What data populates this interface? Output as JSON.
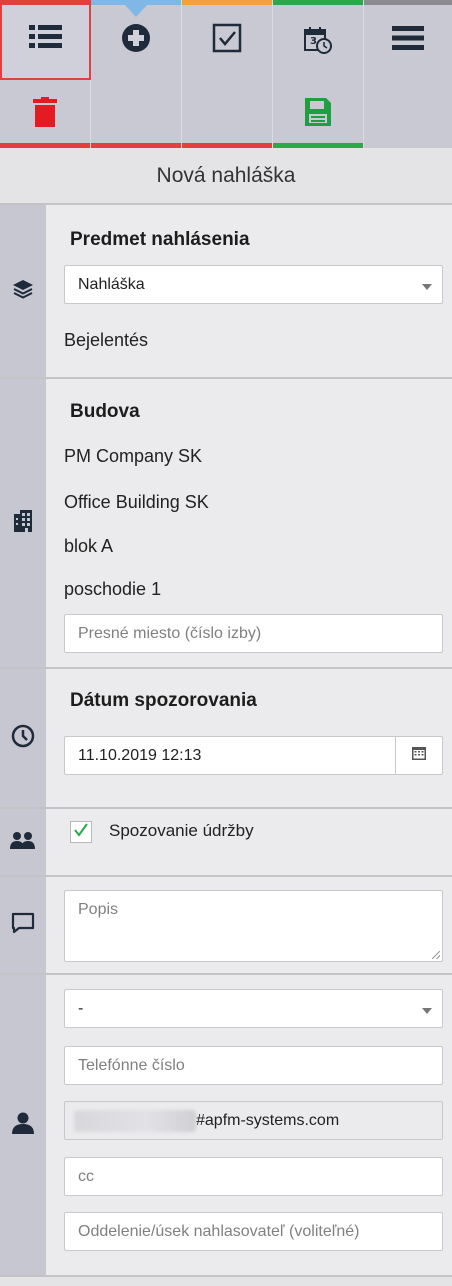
{
  "toolbar": {
    "row1": [
      {
        "name": "list-icon",
        "strip": "#e0403e",
        "selected": true
      },
      {
        "name": "add-circle-icon",
        "strip": "#7fb8e6"
      },
      {
        "name": "checkbox-icon",
        "strip": "#f0a03c"
      },
      {
        "name": "calendar-clock-icon",
        "strip": "#2aa84a"
      },
      {
        "name": "menu-icon",
        "strip": "#8a8a90"
      }
    ],
    "row2": [
      {
        "name": "delete-icon",
        "strip": "#e0403e",
        "color": "#e31b23"
      },
      {
        "name": "empty",
        "strip": "#e0403e"
      },
      {
        "name": "empty",
        "strip": "#e0403e"
      },
      {
        "name": "save-icon",
        "strip": "#2aa84a",
        "color": "#1fa040"
      },
      {
        "name": "empty",
        "strip": "#c9c9d3"
      }
    ],
    "calendar_icon_text": "3"
  },
  "title": "Nová nahláška",
  "subject": {
    "heading": "Predmet nahlásenia",
    "select_value": "Nahláška",
    "secondary_text": "Bejelentés"
  },
  "building": {
    "heading": "Budova",
    "lines": [
      "PM Company SK",
      "Office Building SK",
      "blok A",
      "poschodie 1"
    ],
    "location_placeholder": "Presné miesto (číslo izby)"
  },
  "date": {
    "heading": "Dátum spozorovania",
    "value": "11.10.2019 12:13"
  },
  "maintenance": {
    "checked": true,
    "label": "Spozovanie údržby"
  },
  "description": {
    "placeholder": "Popis"
  },
  "reporter": {
    "select_value": "-",
    "phone_placeholder": "Telefónne číslo",
    "email_suffix": "#apfm-systems.com",
    "cc_placeholder": "cc",
    "department_placeholder": "Oddelenie/úsek nahlasovateľ (voliteľné)"
  },
  "colors": {
    "accent_red": "#e0403e",
    "accent_blue": "#7fb8e6",
    "accent_orange": "#f0a03c",
    "accent_green": "#2aa84a",
    "icon_dark": "#1f2a3a"
  }
}
